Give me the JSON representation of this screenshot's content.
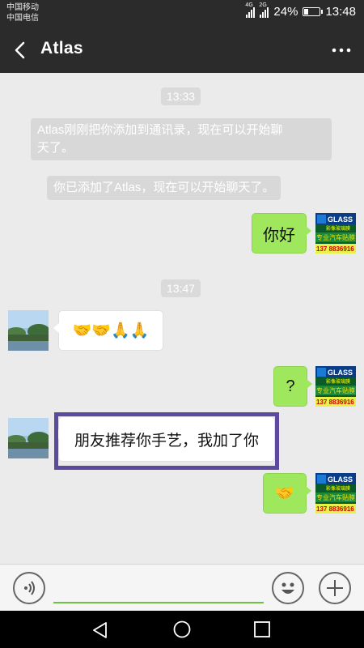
{
  "status_bar": {
    "carrier1": "中国移动",
    "carrier2": "中国电信",
    "net1": "4G",
    "net2": "2G",
    "battery": "24%",
    "battery_level": 0.24,
    "time": "13:48"
  },
  "header": {
    "title": "Atlas",
    "back_icon": "chevron-left-icon",
    "more_icon": "more-dots-icon"
  },
  "messages": {
    "time1": "13:33",
    "sys1_line1": "Atlas刚刚把你添加到通讯录，现在可以开始聊",
    "sys1_line2": "天了。",
    "sys2": "你已添加了Atlas，现在可以开始聊天了。",
    "out1": "你好",
    "time2": "13:47",
    "in1_emoji": "🤝🤝🙏🙏",
    "out2": "?",
    "in2": "朋友推荐你手艺，我加了你",
    "out3_emoji": "🤝"
  },
  "avatar_right": {
    "line1": "GLASS",
    "line2": "影像玻璃膜",
    "line3": "专业汽车贴膜",
    "line4": "137 8836916"
  },
  "input_bar": {
    "placeholder": "",
    "voice_icon": "voice-icon",
    "emoji_icon": "emoji-icon",
    "plus_icon": "plus-icon"
  },
  "colors": {
    "header_bg": "#2b2b2b",
    "chat_bg": "#ebebeb",
    "bubble_out": "#9fe75c",
    "highlight": "#5b4a9e"
  }
}
